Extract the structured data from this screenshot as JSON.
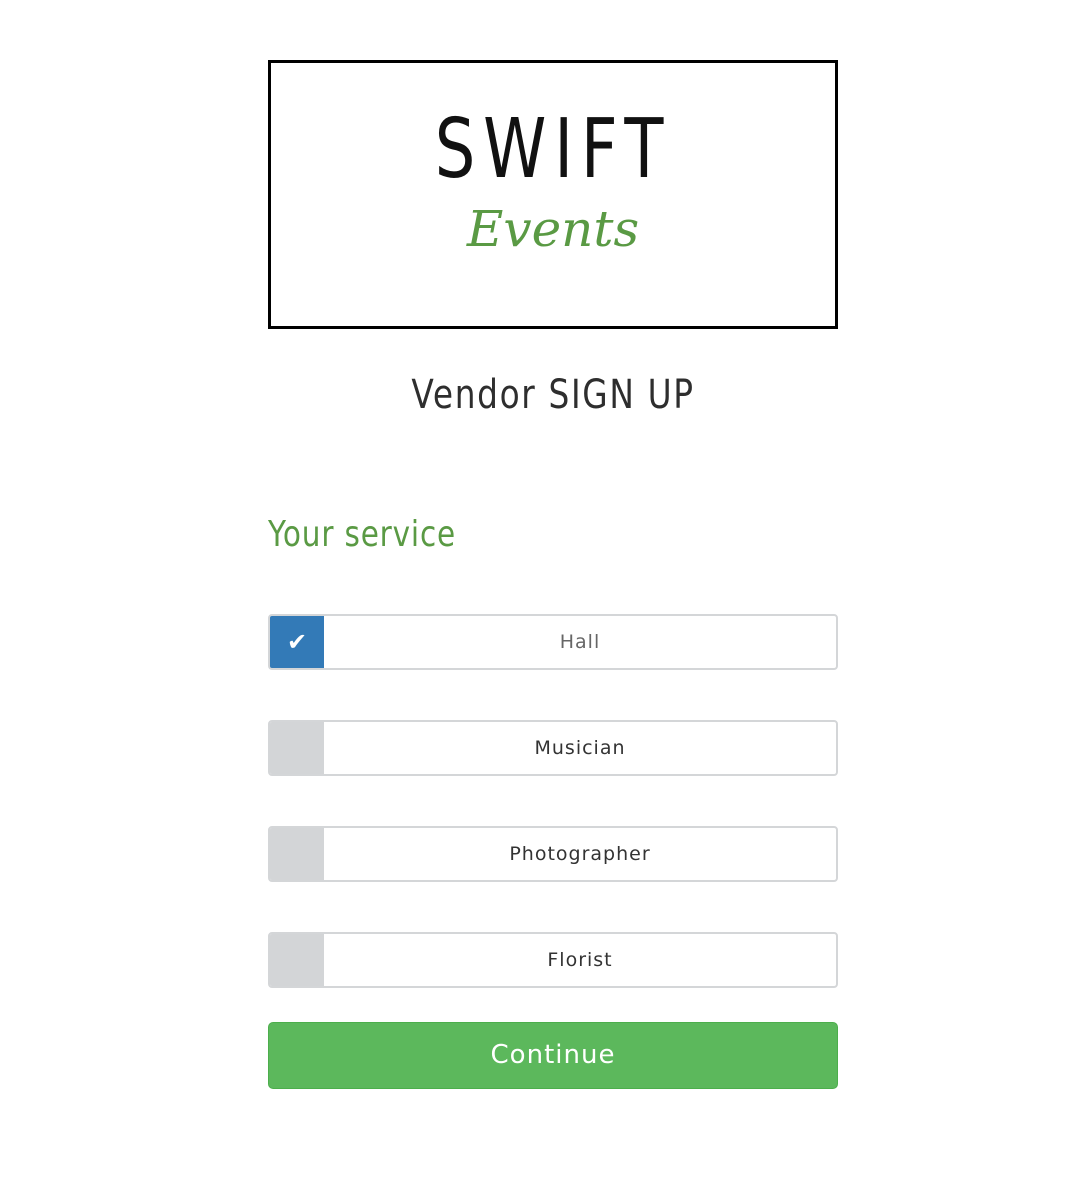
{
  "logo": {
    "title": "SWIFT",
    "subtitle": "Events"
  },
  "page": {
    "title": "Vendor SIGN UP"
  },
  "section": {
    "title": "Your service"
  },
  "options": [
    {
      "label": "Hall",
      "checked": true,
      "check_glyph": "✔"
    },
    {
      "label": "Musician",
      "checked": false
    },
    {
      "label": "Photographer",
      "checked": false
    },
    {
      "label": "Florist",
      "checked": false
    }
  ],
  "actions": {
    "continue_label": "Continue"
  },
  "colors": {
    "accent_green": "#5a9a44",
    "button_green": "#5cb85c",
    "checked_blue": "#337ab7",
    "unchecked_gray": "#d3d5d7"
  }
}
